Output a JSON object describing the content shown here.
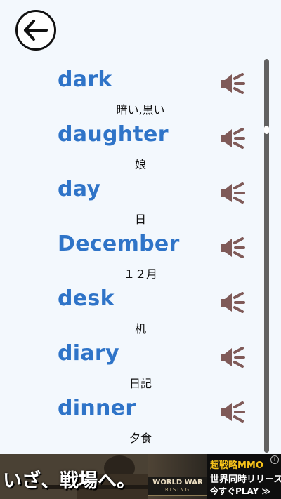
{
  "colors": {
    "word": "#2f74c8",
    "speaker": "#7f5a58",
    "background": "#f3f8fd"
  },
  "header": {
    "back_icon": "arrow-left-icon"
  },
  "words": [
    {
      "word": "dark",
      "meaning": "暗い,黒い",
      "icon": "speaker-icon"
    },
    {
      "word": "daughter",
      "meaning": "娘",
      "icon": "speaker-icon"
    },
    {
      "word": "day",
      "meaning": "日",
      "icon": "speaker-icon"
    },
    {
      "word": "December",
      "meaning": "１２月",
      "icon": "speaker-icon"
    },
    {
      "word": "desk",
      "meaning": "机",
      "icon": "speaker-icon"
    },
    {
      "word": "diary",
      "meaning": "日記",
      "icon": "speaker-icon"
    },
    {
      "word": "dinner",
      "meaning": "夕食",
      "icon": "speaker-icon"
    }
  ],
  "ad": {
    "headline": "いざ、戦場へ。",
    "game_logo_title": "WORLD WAR",
    "game_logo_sub": "RISING",
    "line1": "超戦略MMO",
    "line2": "世界同時リリース",
    "line3": "今すぐPLAY ≫",
    "info_icon": "info-icon"
  }
}
